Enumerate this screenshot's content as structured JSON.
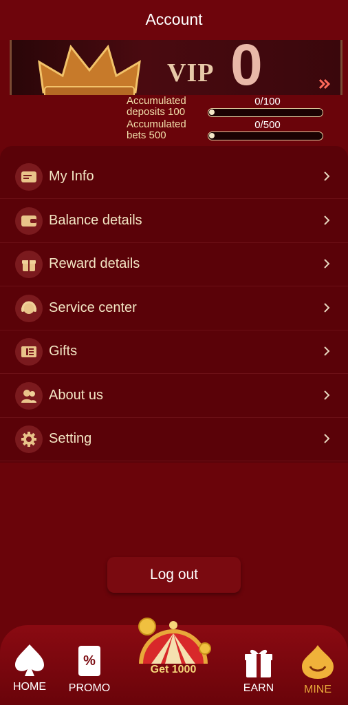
{
  "header": {
    "title": "Account"
  },
  "vip": {
    "label": "VIP",
    "level": "0",
    "deposits": {
      "label": "Accumulated deposits 100",
      "value": "0/100",
      "progress": 0.0
    },
    "bets": {
      "label": "Accumulated bets 500",
      "value": "0/500",
      "progress": 0.0
    }
  },
  "menu": {
    "items": [
      {
        "label": "My Info",
        "icon": "id-card-icon"
      },
      {
        "label": "Balance details",
        "icon": "wallet-icon"
      },
      {
        "label": "Reward details",
        "icon": "gift-box-icon"
      },
      {
        "label": "Service center",
        "icon": "headset-icon"
      },
      {
        "label": "Gifts",
        "icon": "ticket-icon"
      },
      {
        "label": "About us",
        "icon": "users-icon"
      },
      {
        "label": "Setting",
        "icon": "gear-icon"
      }
    ]
  },
  "logout_label": "Log out",
  "tabbar": {
    "home": "HOME",
    "promo": "PROMO",
    "wheel": "Get 1000",
    "earn": "EARN",
    "mine": "MINE",
    "active": "MINE"
  },
  "colors": {
    "background": "#6a040a",
    "menu_bg": "#5a0208",
    "text_cream": "#f3e6c4",
    "accent_gold": "#e8a83a"
  }
}
